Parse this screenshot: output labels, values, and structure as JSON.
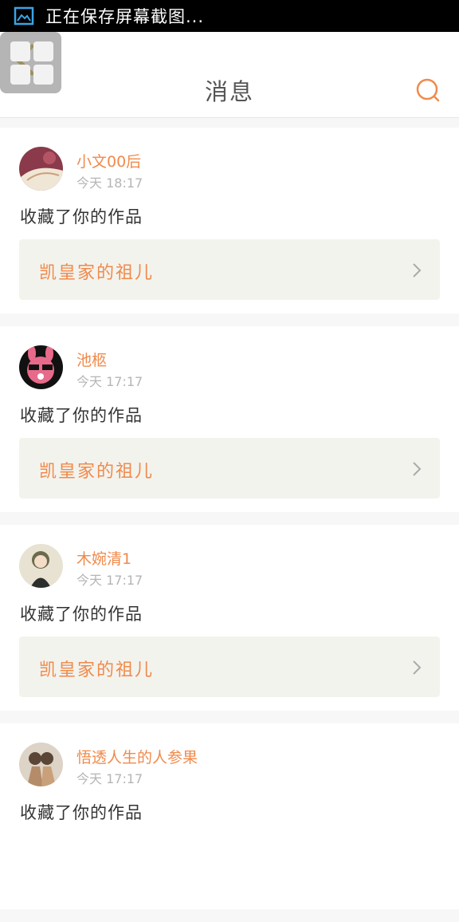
{
  "status_bar": {
    "text": "正在保存屏幕截图..."
  },
  "header": {
    "title": "消息"
  },
  "messages": [
    {
      "username": "小文00后",
      "time": "今天 18:17",
      "action": "收藏了你的作品",
      "work": "凯皇家的祖儿"
    },
    {
      "username": "池柩",
      "time": "今天 17:17",
      "action": "收藏了你的作品",
      "work": "凯皇家的祖儿"
    },
    {
      "username": "木婉清1",
      "time": "今天 17:17",
      "action": "收藏了你的作品",
      "work": "凯皇家的祖儿"
    },
    {
      "username": "悟透人生的人参果",
      "time": "今天 17:17",
      "action": "收藏了你的作品",
      "work": ""
    }
  ],
  "colors": {
    "accent": "#f08a4b",
    "back_arrow": "#c9b23a",
    "card_bg": "#ffffff",
    "work_box_bg": "#f3f3ee"
  },
  "icons": {
    "status": "screenshot-icon",
    "back": "back-arrow-icon",
    "search": "search-icon",
    "chevron": "chevron-right-icon"
  }
}
